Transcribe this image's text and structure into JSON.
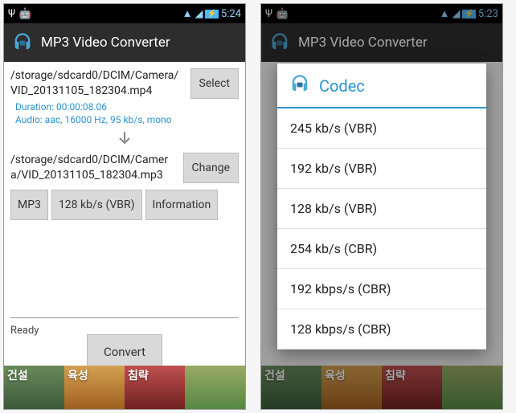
{
  "status": {
    "time_left": "5:24",
    "time_right": "5:23",
    "usb_icon": "usb-icon",
    "android_icon": "android-icon",
    "wifi_icon": "wifi-icon",
    "signal_icon": "signal-icon",
    "battery_icon": "battery-icon"
  },
  "app": {
    "title": "MP3 Video Converter"
  },
  "main": {
    "source_path": "/storage/sdcard0/DCIM/Camera/VID_20131105_182304.mp4",
    "select_label": "Select",
    "meta_duration": "Duration: 00:00:08.06",
    "meta_audio": "Audio: aac, 16000 Hz, 95 kb/s, mono",
    "dest_path": "/storage/sdcard0/DCIM/Camera/VID_20131105_182304.mp3",
    "change_label": "Change",
    "format_label": "MP3",
    "bitrate_label": "128  kb/s (VBR)",
    "info_label": "Information",
    "status_text": "Ready",
    "convert_label": "Convert"
  },
  "ad": {
    "tiles": [
      "건설",
      "육성",
      "침략",
      ""
    ]
  },
  "dialog": {
    "title": "Codec",
    "items": [
      "245 kb/s (VBR)",
      "192  kb/s (VBR)",
      "128  kb/s (VBR)",
      "254 kb/s (CBR)",
      "192 kbps/s (CBR)",
      "128 kbps/s (CBR)"
    ]
  }
}
